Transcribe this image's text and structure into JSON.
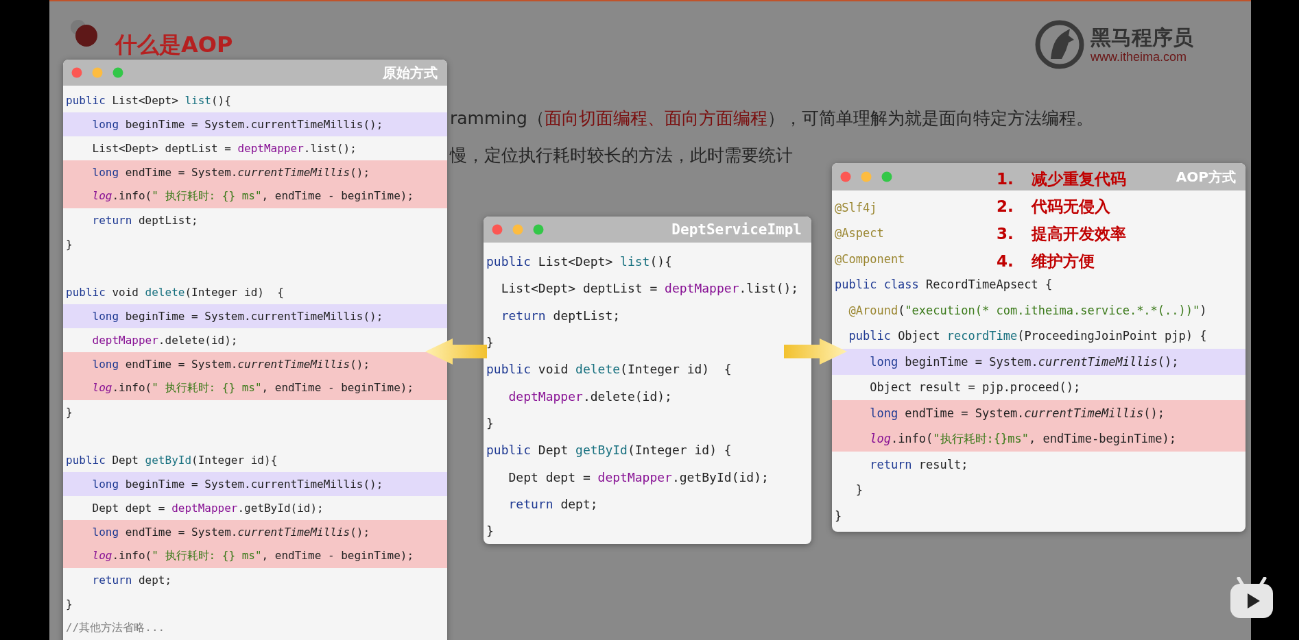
{
  "slide": {
    "title": "什么是AOP",
    "logo": {
      "name": "黑马程序员",
      "url": "www.itheima.com"
    },
    "intro_line": [
      {
        "text": "ramming（",
        "highlight": false
      },
      {
        "text": "面向切面编程、面向方面编程",
        "highlight": true
      },
      {
        "text": "），可简单理解为就是面向特定方法编程。",
        "highlight": false
      }
    ],
    "scenario_line": "慢，定位执行耗时较长的方法，此时需要统计"
  },
  "windows": [
    {
      "title": "原始方式",
      "lines": [
        {
          "kind": "code",
          "tokens": [
            {
              "kind": "kw",
              "text": "public"
            },
            {
              "kind": "plain",
              "text": " List<Dept> "
            },
            {
              "kind": "fn",
              "text": "list"
            },
            {
              "kind": "plain",
              "text": "(){"
            }
          ]
        },
        {
          "kind": "code",
          "color": "#e2dafa",
          "tokens": [
            {
              "kind": "kw",
              "text": "    long"
            },
            {
              "kind": "plain",
              "text": " beginTime = System.currentTimeMillis();"
            }
          ]
        },
        {
          "kind": "code",
          "tokens": [
            {
              "kind": "plain",
              "text": "    List<Dept> deptList = "
            },
            {
              "kind": "field",
              "text": "deptMapper"
            },
            {
              "kind": "plain",
              "text": ".list();"
            }
          ]
        },
        {
          "kind": "code",
          "color": "#f6c6c6",
          "tokens": [
            {
              "kind": "kw",
              "text": "    long"
            },
            {
              "kind": "plain",
              "text": " endTime = System."
            },
            {
              "kind": "static",
              "text": "currentTimeMillis"
            },
            {
              "kind": "plain",
              "text": "();"
            }
          ]
        },
        {
          "kind": "code",
          "color": "#f6c6c6",
          "tokens": [
            {
              "kind": "log",
              "text": "    log"
            },
            {
              "kind": "plain",
              "text": ".info("
            },
            {
              "kind": "str",
              "text": "\" 执行耗时: {} ms\""
            },
            {
              "kind": "plain",
              "text": ", endTime - beginTime);"
            }
          ]
        },
        {
          "kind": "code",
          "tokens": [
            {
              "kind": "kw",
              "text": "    return"
            },
            {
              "kind": "plain",
              "text": " deptList;"
            }
          ]
        },
        {
          "kind": "code",
          "tokens": [
            {
              "kind": "plain",
              "text": "}"
            }
          ]
        },
        {
          "kind": "blank"
        },
        {
          "kind": "code",
          "tokens": [
            {
              "kind": "kw",
              "text": "public"
            },
            {
              "kind": "plain",
              "text": " void "
            },
            {
              "kind": "fn",
              "text": "delete"
            },
            {
              "kind": "plain",
              "text": "(Integer id)  {"
            }
          ]
        },
        {
          "kind": "code",
          "color": "#e2dafa",
          "tokens": [
            {
              "kind": "kw",
              "text": "    long"
            },
            {
              "kind": "plain",
              "text": " beginTime = System.currentTimeMillis();"
            }
          ]
        },
        {
          "kind": "code",
          "tokens": [
            {
              "kind": "field",
              "text": "    deptMapper"
            },
            {
              "kind": "plain",
              "text": ".delete(id);"
            }
          ]
        },
        {
          "kind": "code",
          "color": "#f6c6c6",
          "tokens": [
            {
              "kind": "kw",
              "text": "    long"
            },
            {
              "kind": "plain",
              "text": " endTime = System."
            },
            {
              "kind": "static",
              "text": "currentTimeMillis"
            },
            {
              "kind": "plain",
              "text": "();"
            }
          ]
        },
        {
          "kind": "code",
          "color": "#f6c6c6",
          "tokens": [
            {
              "kind": "log",
              "text": "    log"
            },
            {
              "kind": "plain",
              "text": ".info("
            },
            {
              "kind": "str",
              "text": "\" 执行耗时: {} ms\""
            },
            {
              "kind": "plain",
              "text": ", endTime - beginTime);"
            }
          ]
        },
        {
          "kind": "code",
          "tokens": [
            {
              "kind": "plain",
              "text": "}"
            }
          ]
        },
        {
          "kind": "blank"
        },
        {
          "kind": "code",
          "tokens": [
            {
              "kind": "kw",
              "text": "public"
            },
            {
              "kind": "plain",
              "text": " Dept "
            },
            {
              "kind": "fn",
              "text": "getById"
            },
            {
              "kind": "plain",
              "text": "(Integer id){"
            }
          ]
        },
        {
          "kind": "code",
          "color": "#e2dafa",
          "tokens": [
            {
              "kind": "kw",
              "text": "    long"
            },
            {
              "kind": "plain",
              "text": " beginTime = System.currentTimeMillis();"
            }
          ]
        },
        {
          "kind": "code",
          "tokens": [
            {
              "kind": "plain",
              "text": "    Dept dept = "
            },
            {
              "kind": "field",
              "text": "deptMapper"
            },
            {
              "kind": "plain",
              "text": ".getById(id);"
            }
          ]
        },
        {
          "kind": "code",
          "color": "#f6c6c6",
          "tokens": [
            {
              "kind": "kw",
              "text": "    long"
            },
            {
              "kind": "plain",
              "text": " endTime = System."
            },
            {
              "kind": "static",
              "text": "currentTimeMillis"
            },
            {
              "kind": "plain",
              "text": "();"
            }
          ]
        },
        {
          "kind": "code",
          "color": "#f6c6c6",
          "tokens": [
            {
              "kind": "log",
              "text": "    log"
            },
            {
              "kind": "plain",
              "text": ".info("
            },
            {
              "kind": "str",
              "text": "\" 执行耗时: {} ms\""
            },
            {
              "kind": "plain",
              "text": ", endTime - beginTime);"
            }
          ]
        },
        {
          "kind": "code",
          "tokens": [
            {
              "kind": "kw",
              "text": "    return"
            },
            {
              "kind": "plain",
              "text": " dept;"
            }
          ]
        },
        {
          "kind": "code",
          "tokens": [
            {
              "kind": "plain",
              "text": "}"
            }
          ]
        },
        {
          "kind": "code",
          "tokens": [
            {
              "kind": "comment",
              "text": "//其他方法省略..."
            }
          ]
        }
      ]
    },
    {
      "title": "DeptServiceImpl",
      "lines": [
        {
          "kind": "code",
          "tokens": [
            {
              "kind": "kw",
              "text": "public"
            },
            {
              "kind": "plain",
              "text": " List<Dept> "
            },
            {
              "kind": "fn",
              "text": "list"
            },
            {
              "kind": "plain",
              "text": "(){"
            }
          ]
        },
        {
          "kind": "code",
          "tokens": [
            {
              "kind": "plain",
              "text": "  List<Dept> deptList = "
            },
            {
              "kind": "field",
              "text": "deptMapper"
            },
            {
              "kind": "plain",
              "text": ".list();"
            }
          ]
        },
        {
          "kind": "code",
          "tokens": [
            {
              "kind": "kw",
              "text": "  return"
            },
            {
              "kind": "plain",
              "text": " deptList;"
            }
          ]
        },
        {
          "kind": "code",
          "tokens": [
            {
              "kind": "plain",
              "text": "}"
            }
          ]
        },
        {
          "kind": "code",
          "tokens": [
            {
              "kind": "kw",
              "text": "public"
            },
            {
              "kind": "plain",
              "text": " void "
            },
            {
              "kind": "fn",
              "text": "delete"
            },
            {
              "kind": "plain",
              "text": "(Integer id)  {"
            }
          ]
        },
        {
          "kind": "code",
          "tokens": [
            {
              "kind": "field",
              "text": "   deptMapper"
            },
            {
              "kind": "plain",
              "text": ".delete(id);"
            }
          ]
        },
        {
          "kind": "code",
          "tokens": [
            {
              "kind": "plain",
              "text": "}"
            }
          ]
        },
        {
          "kind": "code",
          "tokens": [
            {
              "kind": "kw",
              "text": "public"
            },
            {
              "kind": "plain",
              "text": " Dept "
            },
            {
              "kind": "fn",
              "text": "getById"
            },
            {
              "kind": "plain",
              "text": "(Integer id) {"
            }
          ]
        },
        {
          "kind": "code",
          "tokens": [
            {
              "kind": "plain",
              "text": "   Dept dept = "
            },
            {
              "kind": "field",
              "text": "deptMapper"
            },
            {
              "kind": "plain",
              "text": ".getById(id);"
            }
          ]
        },
        {
          "kind": "code",
          "tokens": [
            {
              "kind": "kw",
              "text": "   return"
            },
            {
              "kind": "plain",
              "text": " dept;"
            }
          ]
        },
        {
          "kind": "code",
          "tokens": [
            {
              "kind": "plain",
              "text": "}"
            }
          ]
        }
      ]
    },
    {
      "title": "AOP方式",
      "benefits": [
        {
          "number": "1.",
          "text": "减少重复代码"
        },
        {
          "number": "2.",
          "text": "代码无侵入"
        },
        {
          "number": "3.",
          "text": "提高开发效率"
        },
        {
          "number": "4.",
          "text": "维护方便"
        }
      ],
      "lines": [
        {
          "kind": "code",
          "tokens": [
            {
              "kind": "ann",
              "text": "@Slf4j"
            }
          ]
        },
        {
          "kind": "code",
          "tokens": [
            {
              "kind": "ann",
              "text": "@Aspect"
            }
          ]
        },
        {
          "kind": "code",
          "tokens": [
            {
              "kind": "ann",
              "text": "@Component"
            }
          ]
        },
        {
          "kind": "code",
          "tokens": [
            {
              "kind": "kw",
              "text": "public class"
            },
            {
              "kind": "plain",
              "text": " RecordTimeApsect {"
            }
          ]
        },
        {
          "kind": "code",
          "tokens": [
            {
              "kind": "ann",
              "text": "  @Around"
            },
            {
              "kind": "plain",
              "text": "("
            },
            {
              "kind": "str",
              "text": "\"execution(* com.itheima.service.*.*(..))\""
            },
            {
              "kind": "plain",
              "text": ")"
            }
          ]
        },
        {
          "kind": "code",
          "tokens": [
            {
              "kind": "kw",
              "text": "  public"
            },
            {
              "kind": "plain",
              "text": " Object "
            },
            {
              "kind": "fn",
              "text": "recordTime"
            },
            {
              "kind": "plain",
              "text": "(ProceedingJoinPoint pjp) {"
            }
          ]
        },
        {
          "kind": "code",
          "color": "#e2dafa",
          "tokens": [
            {
              "kind": "kw",
              "text": "     long"
            },
            {
              "kind": "plain",
              "text": " beginTime = System."
            },
            {
              "kind": "static",
              "text": "currentTimeMillis"
            },
            {
              "kind": "plain",
              "text": "();"
            }
          ]
        },
        {
          "kind": "code",
          "tokens": [
            {
              "kind": "plain",
              "text": "     Object result = pjp.proceed();"
            }
          ]
        },
        {
          "kind": "code",
          "color": "#f6c6c6",
          "tokens": [
            {
              "kind": "kw",
              "text": "     long"
            },
            {
              "kind": "plain",
              "text": " endTime = System."
            },
            {
              "kind": "static",
              "text": "currentTimeMillis"
            },
            {
              "kind": "plain",
              "text": "();"
            }
          ]
        },
        {
          "kind": "code",
          "color": "#f6c6c6",
          "tokens": [
            {
              "kind": "log",
              "text": "     log"
            },
            {
              "kind": "plain",
              "text": ".info("
            },
            {
              "kind": "str",
              "text": "\"执行耗时:{}ms\""
            },
            {
              "kind": "plain",
              "text": ", endTime-beginTime);"
            }
          ]
        },
        {
          "kind": "code",
          "tokens": [
            {
              "kind": "kw",
              "text": "     return"
            },
            {
              "kind": "plain",
              "text": " result;"
            }
          ]
        },
        {
          "kind": "code",
          "tokens": [
            {
              "kind": "plain",
              "text": "   }"
            }
          ]
        },
        {
          "kind": "code",
          "tokens": [
            {
              "kind": "plain",
              "text": "}"
            }
          ]
        }
      ]
    }
  ]
}
